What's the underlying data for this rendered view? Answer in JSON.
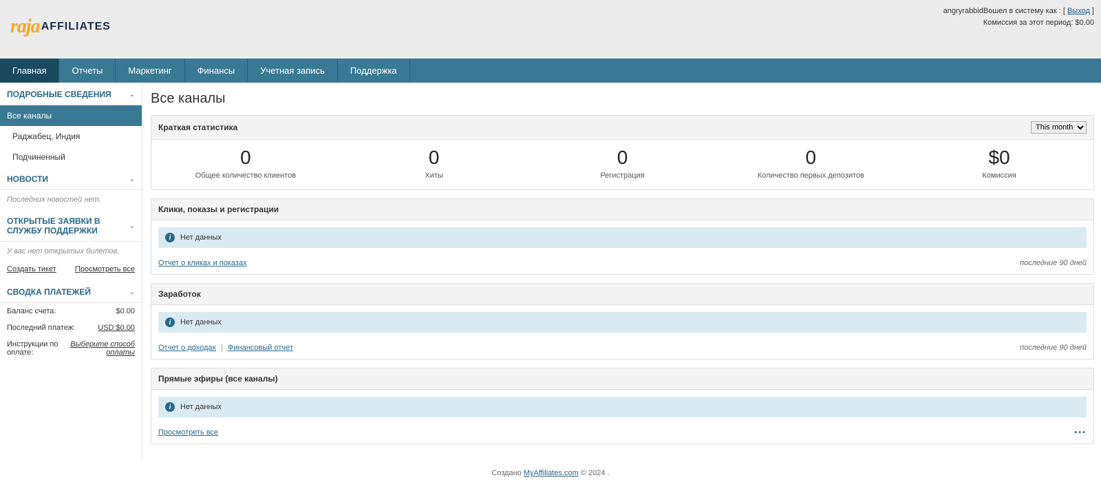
{
  "header": {
    "logo_raja": "raja",
    "logo_affiliates": "AFFILIATES",
    "user_name": "angryrabbid",
    "logged_in_as": "Вошел в систему как :",
    "logout": "Выход",
    "commission_label": "Комиссия за этот период:",
    "commission_value": "$0.00"
  },
  "nav": {
    "items": [
      {
        "label": "Главная",
        "active": true
      },
      {
        "label": "Отчеты",
        "active": false
      },
      {
        "label": "Маркетинг",
        "active": false
      },
      {
        "label": "Финансы",
        "active": false
      },
      {
        "label": "Учетная запись",
        "active": false
      },
      {
        "label": "Поддержка",
        "active": false
      }
    ]
  },
  "sidebar": {
    "details_title": "ПОДРОБНЫЕ СВЕДЕНИЯ",
    "details_items": [
      {
        "label": "Все каналы",
        "active": true,
        "sub": false
      },
      {
        "label": "Раджабец, Индия",
        "active": false,
        "sub": true
      },
      {
        "label": "Подчиненный",
        "active": false,
        "sub": true
      }
    ],
    "news_title": "НОВОСТИ",
    "news_empty": "Последних новостей нет.",
    "tickets_title": "ОТКРЫТЫЕ ЗАЯВКИ В СЛУЖБУ ПОДДЕРЖКИ",
    "tickets_empty": "У вас нет открытых билетов.",
    "create_ticket": "Создать тикет",
    "view_all": "Просмотреть все",
    "payments_title": "СВОДКА ПЛАТЕЖЕЙ",
    "balance_label": "Баланс счета:",
    "balance_value": "$0.00",
    "last_payment_label": "Последний платеж:",
    "last_payment_value": "USD $0.00",
    "payment_instr_label": "Инструкции по оплате:",
    "payment_instr_value": "Выберите способ оплаты"
  },
  "main": {
    "title": "Все каналы",
    "quick_stats_title": "Краткая статистика",
    "period_selected": "This month",
    "stats": [
      {
        "num": "0",
        "label": "Общее количество клиентов"
      },
      {
        "num": "0",
        "label": "Хиты"
      },
      {
        "num": "0",
        "label": "Регистрация"
      },
      {
        "num": "0",
        "label": "Количество первых депозитов"
      },
      {
        "num": "$0",
        "label": "Комиссия"
      }
    ],
    "panel_clicks_title": "Клики, показы и регистрации",
    "no_data": "Нет данных",
    "clicks_report": "Отчет о кликах и показах",
    "last_90": "последние 90 дней",
    "panel_earnings_title": "Заработок",
    "earnings_report": "Отчет о доходах",
    "finance_report": "Финансовый отчет",
    "panel_live_title": "Прямые эфиры (все каналы)",
    "view_all": "Просмотреть все"
  },
  "footer": {
    "created_by": "Создано",
    "link": "MyAffiliates.com",
    "year": "© 2024 ."
  }
}
